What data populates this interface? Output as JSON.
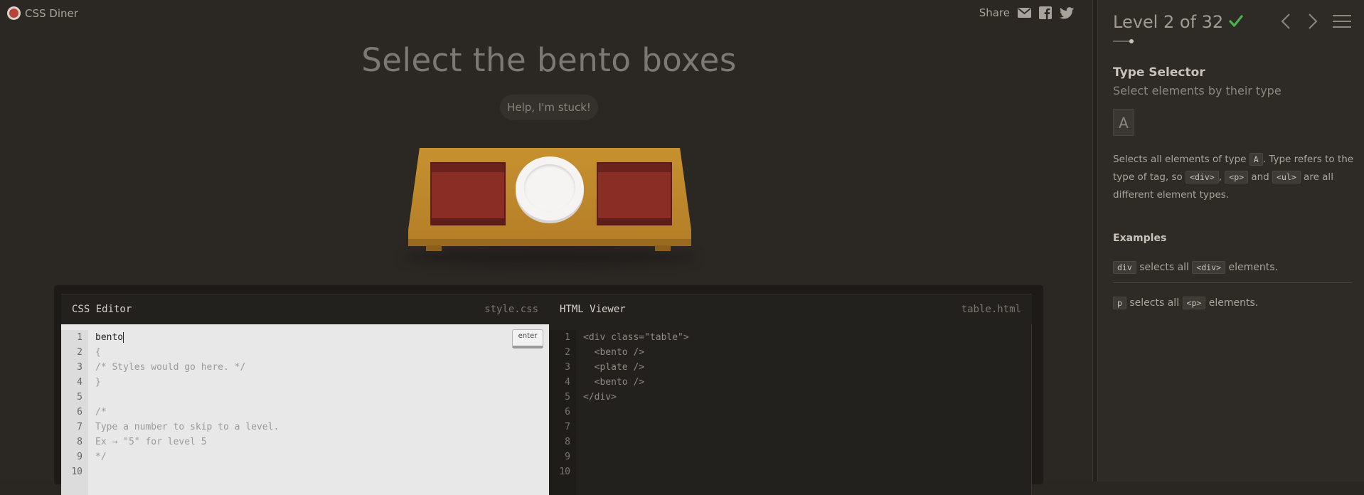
{
  "app": {
    "logo_label": "CSS Diner"
  },
  "share": {
    "label": "Share",
    "icons": [
      "mail-icon",
      "facebook-icon",
      "twitter-icon"
    ]
  },
  "game": {
    "instruction": "Select the bento boxes",
    "help_button": "Help, I'm stuck!",
    "table_items": [
      "bento",
      "plate",
      "bento"
    ]
  },
  "css_editor": {
    "title": "CSS Editor",
    "filename": "style.css",
    "enter_label": "enter",
    "input_value": "bento",
    "line_numbers": "1\n2\n3\n4\n5\n6\n7\n8\n9\n10",
    "rest_lines": "{\n/* Styles would go here. */\n}\n\n/*\nType a number to skip to a level.\nEx → \"5\" for level 5\n*/\n"
  },
  "html_viewer": {
    "title": "HTML Viewer",
    "filename": "table.html",
    "line_numbers": "1\n2\n3\n4\n5\n6\n7\n8\n9\n10",
    "code": "<div class=\"table\">\n  <bento />\n  <plate />\n  <bento />\n</div>\n\n\n\n\n"
  },
  "sidebar": {
    "level_text": "Level 2 of 32",
    "completed": true,
    "progress_fraction": 0.0625,
    "selector_name": "Type Selector",
    "selector_desc": "Select elements by their type",
    "syntax": "A",
    "help": {
      "p1": "Selects all elements of type ",
      "code_a": "A",
      "p2": ". Type refers to the type of tag, so ",
      "code_div": "<div>",
      "sep1": ", ",
      "code_p": "<p>",
      "and": " and ",
      "code_ul": "<ul>",
      "p3": " are all different element types."
    },
    "examples_heading": "Examples",
    "examples": [
      {
        "code": "div",
        "mid": " selects all ",
        "tag": "<div>",
        "end": " elements."
      },
      {
        "code": "p",
        "mid": " selects all ",
        "tag": "<p>",
        "end": " elements."
      }
    ]
  },
  "colors": {
    "accent_check": "#4caf50",
    "bento": "#8a2d25",
    "table": "#c7902f"
  }
}
